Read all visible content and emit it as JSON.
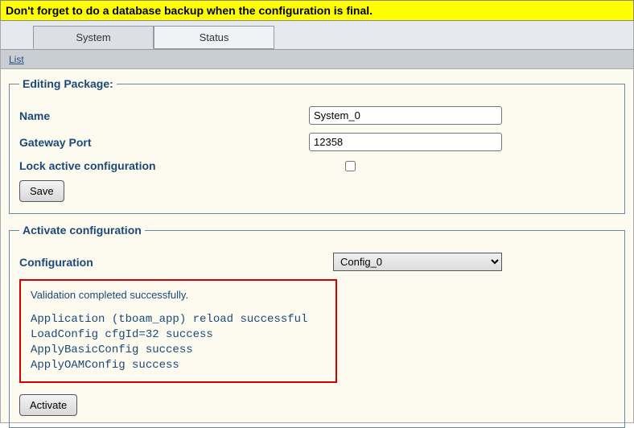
{
  "banner": {
    "text": "Don't forget to do a database backup when the configuration is final."
  },
  "tabs": {
    "system": "System",
    "status": "Status"
  },
  "subnav": {
    "list": "List"
  },
  "editing": {
    "legend": "Editing Package:",
    "name_label": "Name",
    "name_value": "System_0",
    "gateway_label": "Gateway Port",
    "gateway_value": "12358",
    "lock_label": "Lock active configuration",
    "save_label": "Save"
  },
  "activate": {
    "legend": "Activate configuration",
    "config_label": "Configuration",
    "config_selected": "Config_0",
    "log_head": "Validation completed successfully.",
    "log_body": "Application (tboam_app) reload successful\nLoadConfig cfgId=32 success\nApplyBasicConfig success\nApplyOAMConfig success",
    "activate_label": "Activate"
  }
}
